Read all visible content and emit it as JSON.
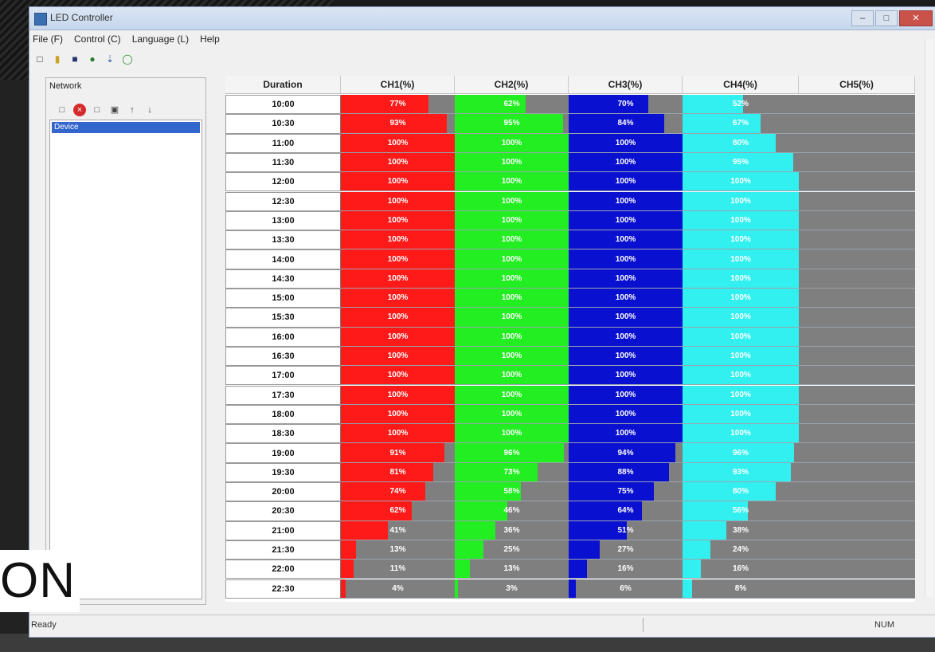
{
  "window": {
    "title": "LED Controller"
  },
  "menu": [
    "File (F)",
    "Control (C)",
    "Language (L)",
    "Help"
  ],
  "toolbar_icons": [
    "new-icon",
    "open-icon",
    "save-icon",
    "sync-icon",
    "export-icon",
    "clock-icon"
  ],
  "left_panel": {
    "title": "Network",
    "selected_item": "Device"
  },
  "table": {
    "time_header": "Duration",
    "channel_headers": [
      "CH1(%)",
      "CH2(%)",
      "CH3(%)",
      "CH4(%)",
      "CH5(%)"
    ],
    "channel_colors": [
      "#ff1a1a",
      "#22ee22",
      "#0a10d0",
      "#33f0f0",
      "#7f7f7f"
    ],
    "rows": [
      {
        "time": "10:00",
        "levels": [
          77,
          62,
          70,
          52,
          0
        ]
      },
      {
        "time": "10:30",
        "levels": [
          93,
          95,
          84,
          67,
          0
        ]
      },
      {
        "time": "11:00",
        "levels": [
          100,
          100,
          100,
          80,
          0
        ]
      },
      {
        "time": "11:30",
        "levels": [
          100,
          100,
          100,
          95,
          0
        ]
      },
      {
        "time": "12:00",
        "levels": [
          100,
          100,
          100,
          100,
          0
        ]
      },
      {
        "time": "12:30",
        "levels": [
          100,
          100,
          100,
          100,
          0
        ]
      },
      {
        "time": "13:00",
        "levels": [
          100,
          100,
          100,
          100,
          0
        ]
      },
      {
        "time": "13:30",
        "levels": [
          100,
          100,
          100,
          100,
          0
        ]
      },
      {
        "time": "14:00",
        "levels": [
          100,
          100,
          100,
          100,
          0
        ]
      },
      {
        "time": "14:30",
        "levels": [
          100,
          100,
          100,
          100,
          0
        ]
      },
      {
        "time": "15:00",
        "levels": [
          100,
          100,
          100,
          100,
          0
        ]
      },
      {
        "time": "15:30",
        "levels": [
          100,
          100,
          100,
          100,
          0
        ]
      },
      {
        "time": "16:00",
        "levels": [
          100,
          100,
          100,
          100,
          0
        ]
      },
      {
        "time": "16:30",
        "levels": [
          100,
          100,
          100,
          100,
          0
        ]
      },
      {
        "time": "17:00",
        "levels": [
          100,
          100,
          100,
          100,
          0
        ]
      },
      {
        "time": "17:30",
        "levels": [
          100,
          100,
          100,
          100,
          0
        ]
      },
      {
        "time": "18:00",
        "levels": [
          100,
          100,
          100,
          100,
          0
        ]
      },
      {
        "time": "18:30",
        "levels": [
          100,
          100,
          100,
          100,
          0
        ]
      },
      {
        "time": "19:00",
        "levels": [
          91,
          96,
          94,
          96,
          0
        ]
      },
      {
        "time": "19:30",
        "levels": [
          81,
          73,
          88,
          93,
          0
        ]
      },
      {
        "time": "20:00",
        "levels": [
          74,
          58,
          75,
          80,
          0
        ]
      },
      {
        "time": "20:30",
        "levels": [
          62,
          46,
          64,
          56,
          0
        ]
      },
      {
        "time": "21:00",
        "levels": [
          41,
          36,
          51,
          38,
          0
        ]
      },
      {
        "time": "21:30",
        "levels": [
          13,
          25,
          27,
          24,
          0
        ]
      },
      {
        "time": "22:00",
        "levels": [
          11,
          13,
          16,
          16,
          0
        ]
      },
      {
        "time": "22:30",
        "levels": [
          4,
          3,
          6,
          8,
          0
        ]
      }
    ]
  },
  "status": {
    "left": "Ready",
    "right": "NUM"
  },
  "watermark": "ON"
}
